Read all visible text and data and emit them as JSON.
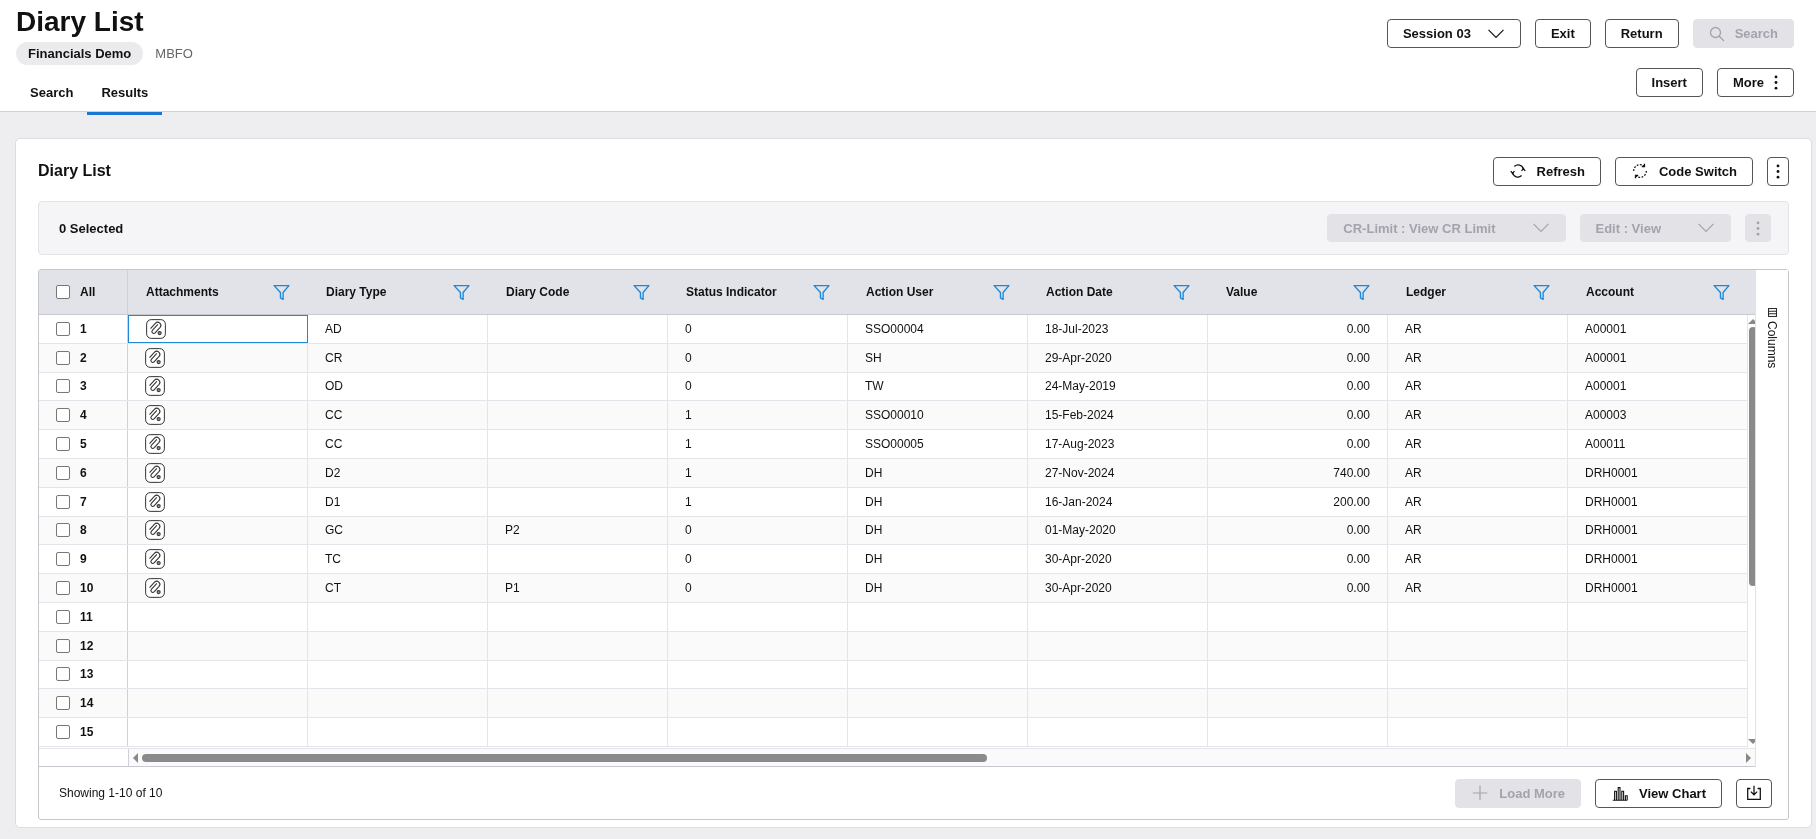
{
  "header": {
    "title": "Diary List",
    "company": "Financials Demo",
    "code": "MBFO"
  },
  "tabs": [
    {
      "label": "Search",
      "selected": false
    },
    {
      "label": "Results",
      "selected": true
    }
  ],
  "top_actions": [
    {
      "kind": "dropdown",
      "label": "Session 03",
      "disabled": false
    },
    {
      "kind": "button",
      "label": "Exit",
      "disabled": false
    },
    {
      "kind": "button",
      "label": "Return",
      "disabled": false
    },
    {
      "kind": "search",
      "label": "Search",
      "disabled": true
    }
  ],
  "page_actions": [
    {
      "kind": "button",
      "label": "Insert"
    },
    {
      "kind": "more",
      "label": "More"
    }
  ],
  "card": {
    "title": "Diary List",
    "actions": [
      {
        "kind": "refresh",
        "label": "Refresh"
      },
      {
        "kind": "switch",
        "label": "Code Switch"
      },
      {
        "kind": "kebab"
      }
    ]
  },
  "selection_bar": {
    "count": "0 Selected",
    "actions": [
      {
        "kind": "dropdown",
        "label": "CR-Limit : View CR Limit",
        "disabled": true
      },
      {
        "kind": "dropdown",
        "label": "Edit : View",
        "disabled": true
      },
      {
        "kind": "kebab",
        "disabled": true
      }
    ]
  },
  "table": {
    "select_all": {
      "label": "All",
      "checked": false
    },
    "columns": [
      "Attachments",
      "Diary Type",
      "Diary Code",
      "Status Indicator",
      "Action User",
      "Action Date",
      "Value",
      "Ledger",
      "Account"
    ],
    "rows": [
      {
        "number": "1",
        "checked": false,
        "focused": true,
        "attachment": true,
        "diary_type": "AD",
        "status_indicator": "0",
        "action_user": "SSO00004",
        "action_date": "18-Jul-2023",
        "value": "0.00",
        "ledger": "AR",
        "account": "A00001"
      },
      {
        "number": "2",
        "checked": false,
        "focused": false,
        "attachment": true,
        "diary_type": "CR",
        "status_indicator": "0",
        "action_user": "SH",
        "action_date": "29-Apr-2020",
        "value": "0.00",
        "ledger": "AR",
        "account": "A00001"
      },
      {
        "number": "3",
        "checked": false,
        "focused": false,
        "attachment": true,
        "diary_type": "OD",
        "status_indicator": "0",
        "action_user": "TW",
        "action_date": "24-May-2019",
        "value": "0.00",
        "ledger": "AR",
        "account": "A00001"
      },
      {
        "number": "4",
        "checked": false,
        "focused": false,
        "attachment": true,
        "diary_type": "CC",
        "status_indicator": "1",
        "action_user": "SSO00010",
        "action_date": "15-Feb-2024",
        "value": "0.00",
        "ledger": "AR",
        "account": "A00003"
      },
      {
        "number": "5",
        "checked": false,
        "focused": false,
        "attachment": true,
        "diary_type": "CC",
        "status_indicator": "1",
        "action_user": "SSO00005",
        "action_date": "17-Aug-2023",
        "value": "0.00",
        "ledger": "AR",
        "account": "A00011"
      },
      {
        "number": "6",
        "checked": false,
        "focused": false,
        "attachment": true,
        "diary_type": "D2",
        "status_indicator": "1",
        "action_user": "DH",
        "action_date": "27-Nov-2024",
        "value": "740.00",
        "ledger": "AR",
        "account": "DRH0001"
      },
      {
        "number": "7",
        "checked": false,
        "focused": false,
        "attachment": true,
        "diary_type": "D1",
        "status_indicator": "1",
        "action_user": "DH",
        "action_date": "16-Jan-2024",
        "value": "200.00",
        "ledger": "AR",
        "account": "DRH0001"
      },
      {
        "number": "8",
        "checked": false,
        "focused": false,
        "attachment": true,
        "diary_type": "GC",
        "diary_code": "P2",
        "status_indicator": "0",
        "action_user": "DH",
        "action_date": "01-May-2020",
        "value": "0.00",
        "ledger": "AR",
        "account": "DRH0001"
      },
      {
        "number": "9",
        "checked": false,
        "focused": false,
        "attachment": true,
        "diary_type": "TC",
        "status_indicator": "0",
        "action_user": "DH",
        "action_date": "30-Apr-2020",
        "value": "0.00",
        "ledger": "AR",
        "account": "DRH0001"
      },
      {
        "number": "10",
        "checked": false,
        "focused": false,
        "attachment": true,
        "diary_type": "CT",
        "diary_code": "P1",
        "status_indicator": "0",
        "action_user": "DH",
        "action_date": "30-Apr-2020",
        "value": "0.00",
        "ledger": "AR",
        "account": "DRH0001"
      },
      {
        "number": "11",
        "checked": false,
        "focused": false
      },
      {
        "number": "12",
        "checked": false,
        "focused": false
      },
      {
        "number": "13",
        "checked": false,
        "focused": false
      },
      {
        "number": "14",
        "checked": false,
        "focused": false
      },
      {
        "number": "15",
        "checked": false,
        "focused": false
      }
    ],
    "side_panel": "Columns"
  },
  "footer": {
    "summary": "Showing 1-10 of 10",
    "actions": [
      {
        "kind": "add",
        "label": "Load More",
        "disabled": true
      },
      {
        "kind": "chart",
        "label": "View Chart",
        "disabled": false
      },
      {
        "kind": "download",
        "disabled": false
      }
    ]
  }
}
